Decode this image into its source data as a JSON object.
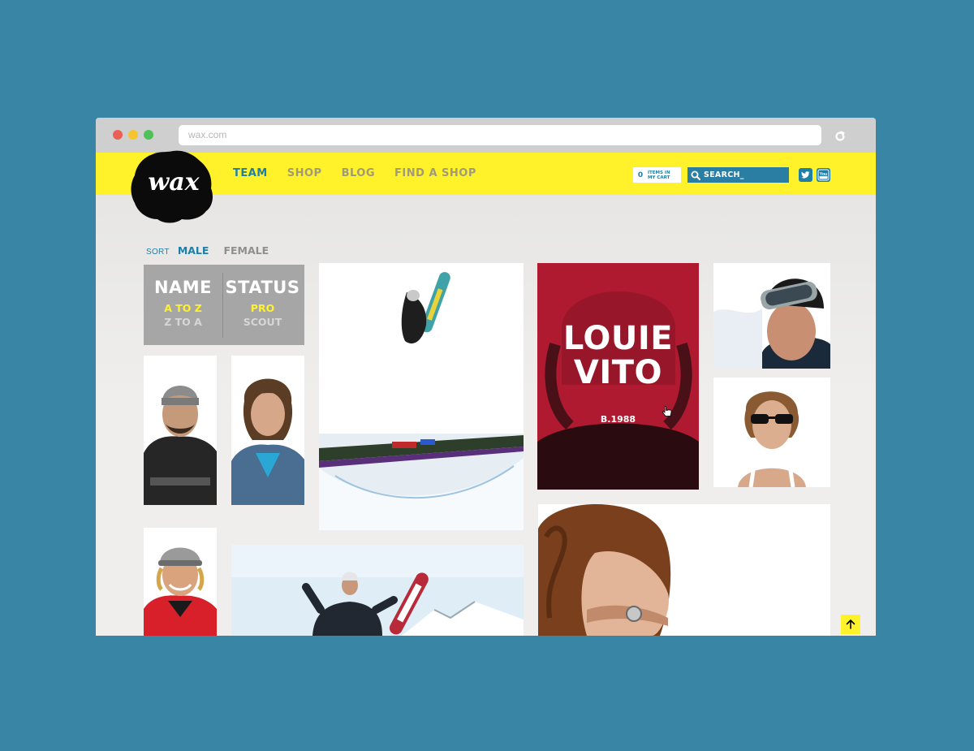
{
  "browser": {
    "url": "wax.com"
  },
  "brand": {
    "logo_text": "wax",
    "yellow": "#fff22b",
    "blue": "#1f7fa7",
    "feature_red": "#b01a30"
  },
  "nav": {
    "items": [
      "TEAM",
      "SHOP",
      "BLOG",
      "FIND A SHOP"
    ],
    "active": "TEAM"
  },
  "cart": {
    "count": "0",
    "label_line1": "ITEMS IN",
    "label_line2": "MY CART"
  },
  "search": {
    "text": "SEARCH_",
    "icon": "search-icon"
  },
  "social": {
    "icons": [
      "twitter-icon",
      "youtube-icon"
    ],
    "youtube_text": "You"
  },
  "sort": {
    "label": "SORT",
    "options": [
      "MALE",
      "FEMALE"
    ],
    "selected": "MALE"
  },
  "filters": {
    "name": {
      "title": "NAME",
      "options": [
        "A TO Z",
        "Z TO A"
      ],
      "selected": "A TO Z"
    },
    "status": {
      "title": "STATUS",
      "options": [
        "PRO",
        "SCOUT"
      ],
      "selected": "PRO"
    }
  },
  "featured_rider": {
    "first_name": "LOUIE",
    "last_name": "VITO",
    "born": "B.1988"
  },
  "scroll_top_icon": "arrow-up-icon"
}
